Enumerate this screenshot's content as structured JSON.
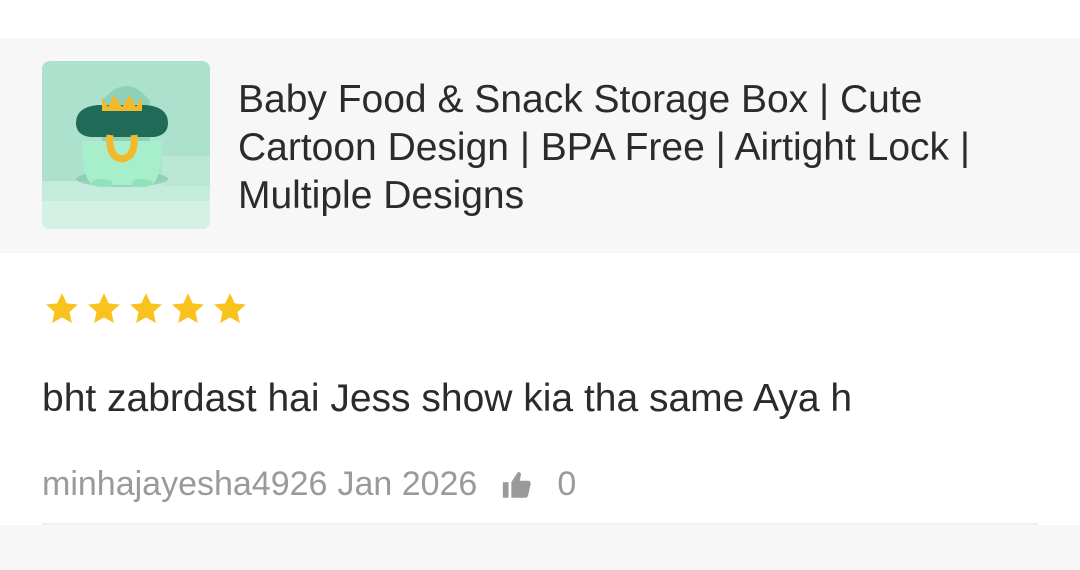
{
  "product": {
    "title": "Baby Food & Snack Storage Box | Cute Cartoon Design | BPA Free | Airtight Lock | Multiple Designs",
    "image_icon": "product-image"
  },
  "review": {
    "rating": 5,
    "rating_max": 5,
    "text": "bht zabrdast hai Jess show kia tha same Aya h",
    "username": "minhajayesha4926",
    "date": "Jan 2026",
    "like_count": "0",
    "like_icon": "thumbs-up-icon"
  },
  "colors": {
    "star": "#f9c21d",
    "text_primary": "#2b2b2b",
    "text_secondary": "#9a9a9a",
    "card_bg": "#f7f7f7"
  }
}
